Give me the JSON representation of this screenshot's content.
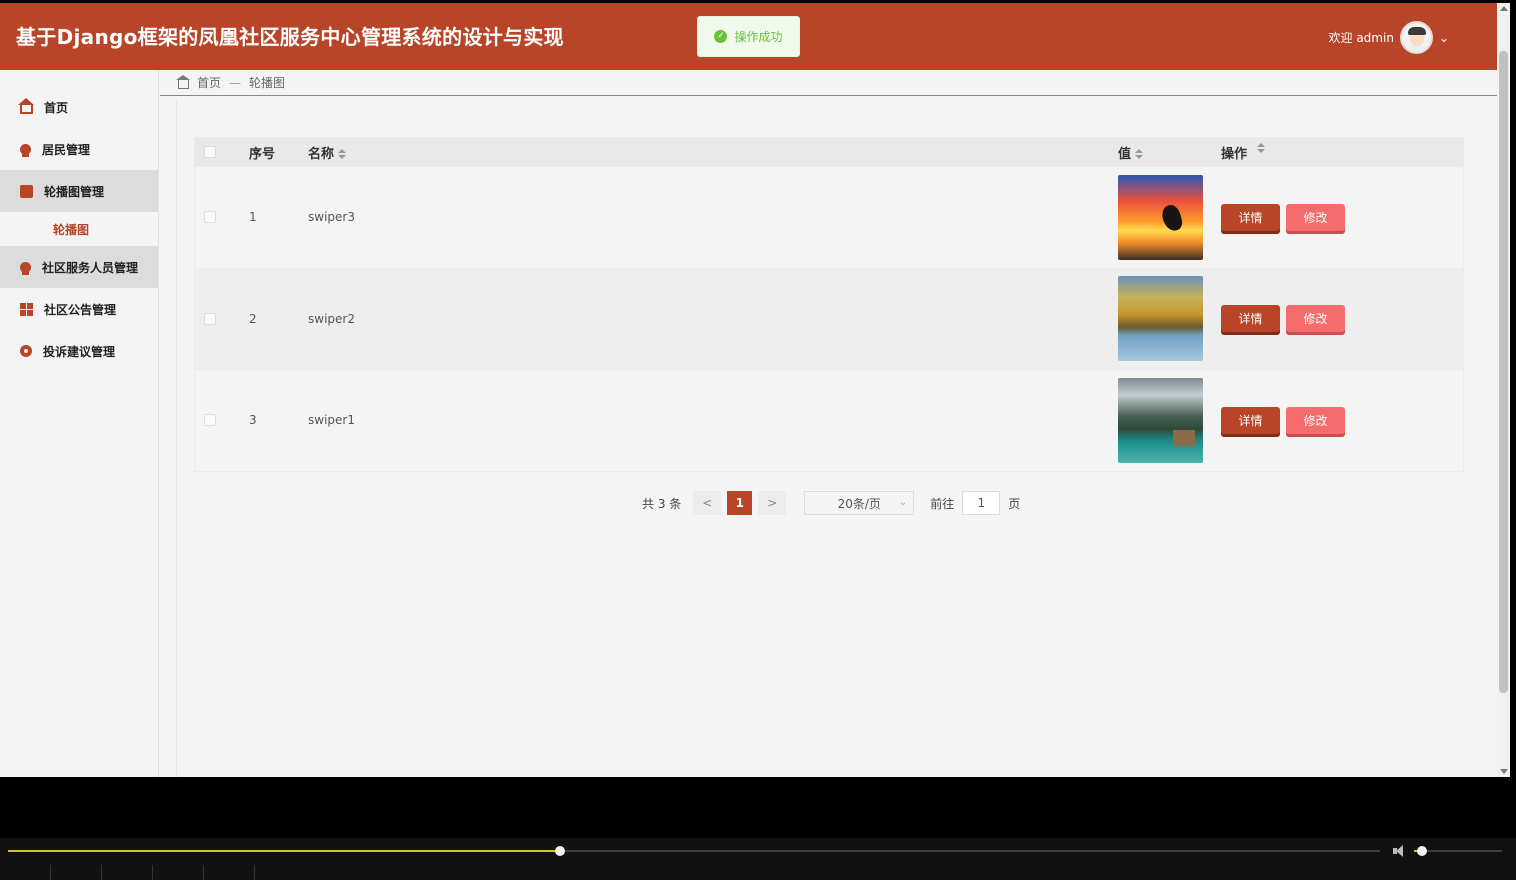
{
  "header": {
    "title": "基于Django框架的凤凰社区服务中心管理系统的设计与实现",
    "toast": "操作成功",
    "welcome": "欢迎 admin"
  },
  "sidebar": {
    "items": [
      {
        "label": "首页",
        "icon": "home-icon"
      },
      {
        "label": "居民管理",
        "icon": "user-badge-icon"
      },
      {
        "label": "轮播图管理",
        "icon": "picture-icon"
      },
      {
        "label": "轮播图",
        "icon": ""
      },
      {
        "label": "社区服务人员管理",
        "icon": "user-badge-icon"
      },
      {
        "label": "社区公告管理",
        "icon": "grid-icon"
      },
      {
        "label": "投诉建议管理",
        "icon": "circle-icon"
      }
    ]
  },
  "breadcrumb": {
    "home": "首页",
    "separator": "—",
    "current": "轮播图"
  },
  "table": {
    "columns": {
      "index": "序号",
      "name": "名称",
      "value": "值",
      "action": "操作"
    },
    "rows": [
      {
        "index": "1",
        "name": "swiper3",
        "thumb": "sunset-dolphin"
      },
      {
        "index": "2",
        "name": "swiper2",
        "thumb": "autumn-river"
      },
      {
        "index": "3",
        "name": "swiper1",
        "thumb": "mountain-lake"
      }
    ],
    "detail_label": "详情",
    "edit_label": "修改"
  },
  "pagination": {
    "total": "共 3 条",
    "prev": "<",
    "current_page": "1",
    "next": ">",
    "page_size": "20条/页",
    "goto_label": "前往",
    "goto_value": "1",
    "page_unit": "页"
  },
  "player": {
    "progress_fraction": 0.402,
    "volume_fraction": 0.09
  },
  "colors": {
    "brand": "#b84528",
    "danger": "#f56c6c",
    "success": "#67c23a",
    "progress": "#d9c21d"
  }
}
